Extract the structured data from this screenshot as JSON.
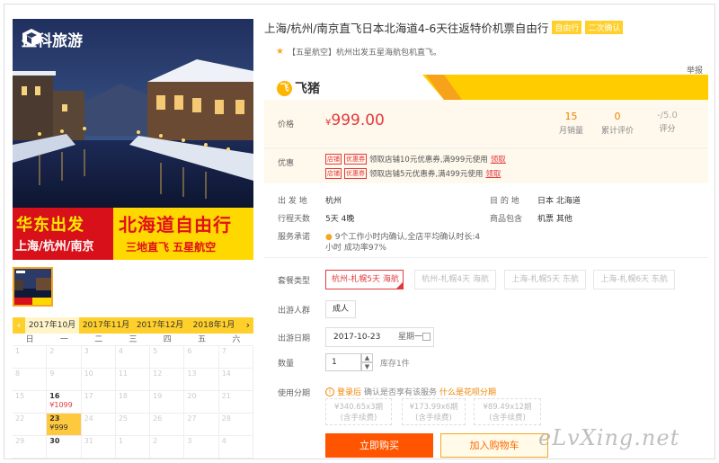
{
  "hero": {
    "brand_name": "盈科旅游",
    "banner_left_top": "华东出发",
    "banner_left_bottom": "上海/杭州/南京",
    "banner_right_top": "北海道自由行",
    "banner_right_bottom": "三地直飞    五星航空"
  },
  "calendar": {
    "months": [
      "2017年10月",
      "2017年11月",
      "2017年12月",
      "2018年1月"
    ],
    "weekdays": [
      "日",
      "一",
      "二",
      "三",
      "四",
      "五",
      "六"
    ],
    "cells": [
      {
        "d": "1"
      },
      {
        "d": "2"
      },
      {
        "d": "3"
      },
      {
        "d": "4"
      },
      {
        "d": "5"
      },
      {
        "d": "6"
      },
      {
        "d": "7"
      },
      {
        "d": "8"
      },
      {
        "d": "9"
      },
      {
        "d": "10"
      },
      {
        "d": "11"
      },
      {
        "d": "12"
      },
      {
        "d": "13"
      },
      {
        "d": "14"
      },
      {
        "d": "15"
      },
      {
        "d": "16",
        "price": "¥1099"
      },
      {
        "d": "17"
      },
      {
        "d": "18"
      },
      {
        "d": "19"
      },
      {
        "d": "20"
      },
      {
        "d": "21"
      },
      {
        "d": "22"
      },
      {
        "d": "23",
        "price": "¥999"
      },
      {
        "d": "24"
      },
      {
        "d": "25"
      },
      {
        "d": "26"
      },
      {
        "d": "27"
      },
      {
        "d": "28"
      },
      {
        "d": "29"
      },
      {
        "d": "30"
      },
      {
        "d": "31"
      },
      {
        "d": "1"
      },
      {
        "d": "2"
      },
      {
        "d": "3"
      },
      {
        "d": "4"
      }
    ]
  },
  "product": {
    "title": "上海/杭州/南京直飞日本北海道4-6天往返特价机票自由行",
    "tag1": "自由行",
    "tag2": "二次确认",
    "subline": "【五星航空】杭州出发五星海航包机直飞。",
    "report": "举报"
  },
  "fliggy": {
    "logo_text": "飞猪",
    "logo_mark": "飞"
  },
  "price": {
    "label": "价格",
    "currency": "¥",
    "value": "999.00",
    "sales_num": "15",
    "sales_label": "月销量",
    "reviews_num": "0",
    "reviews_label": "累计评价",
    "rating_num": "-/5.0",
    "rating_label": "评分"
  },
  "promo": {
    "label": "优惠",
    "tag_a": "店铺",
    "tag_b": "优惠券",
    "line1": "领取店铺10元优惠券,满999元使用",
    "line2": "领取店铺5元优惠券,满499元使用",
    "link": "领取"
  },
  "info": {
    "depart_label": "出 发 地",
    "depart_val": "杭州",
    "dest_label": "目 的 地",
    "dest_val": "日本  北海道",
    "days_label": "行程天数",
    "days_val": "5天  4晚",
    "includes_label": "商品包含",
    "includes_val": "机票  其他",
    "promise_label": "服务承诺",
    "promise_line1": "9个工作小时内确认,全店平均确认时长:4",
    "promise_line2": "小时 成功率97%"
  },
  "options": {
    "package_label": "套餐类型",
    "packages": [
      "杭州-札幌5天 海航",
      "杭州-札幌4天 海航",
      "上海-札幌5天 东航",
      "上海-札幌6天 东航"
    ],
    "crowd_label": "出游人群",
    "crowd_val": "成人",
    "date_label": "出游日期",
    "date_val": "2017-10-23",
    "weekday_val": "星期一",
    "qty_label": "数量",
    "qty_val": "1",
    "stock": "库存1件",
    "installment_label": "使用分期",
    "installment_note1": "登录后",
    "installment_note2": "确认是否享有该服务",
    "installment_link": "什么是花呗分期",
    "installments": [
      {
        "amount": "¥340.65x3期",
        "fee": "(含手续费)"
      },
      {
        "amount": "¥173.99x6期",
        "fee": "(含手续费)"
      },
      {
        "amount": "¥89.49x12期",
        "fee": "(含手续费)"
      }
    ]
  },
  "actions": {
    "buy": "立即购买",
    "cart": "加入购物车"
  },
  "watermark": "eLvXing.net"
}
